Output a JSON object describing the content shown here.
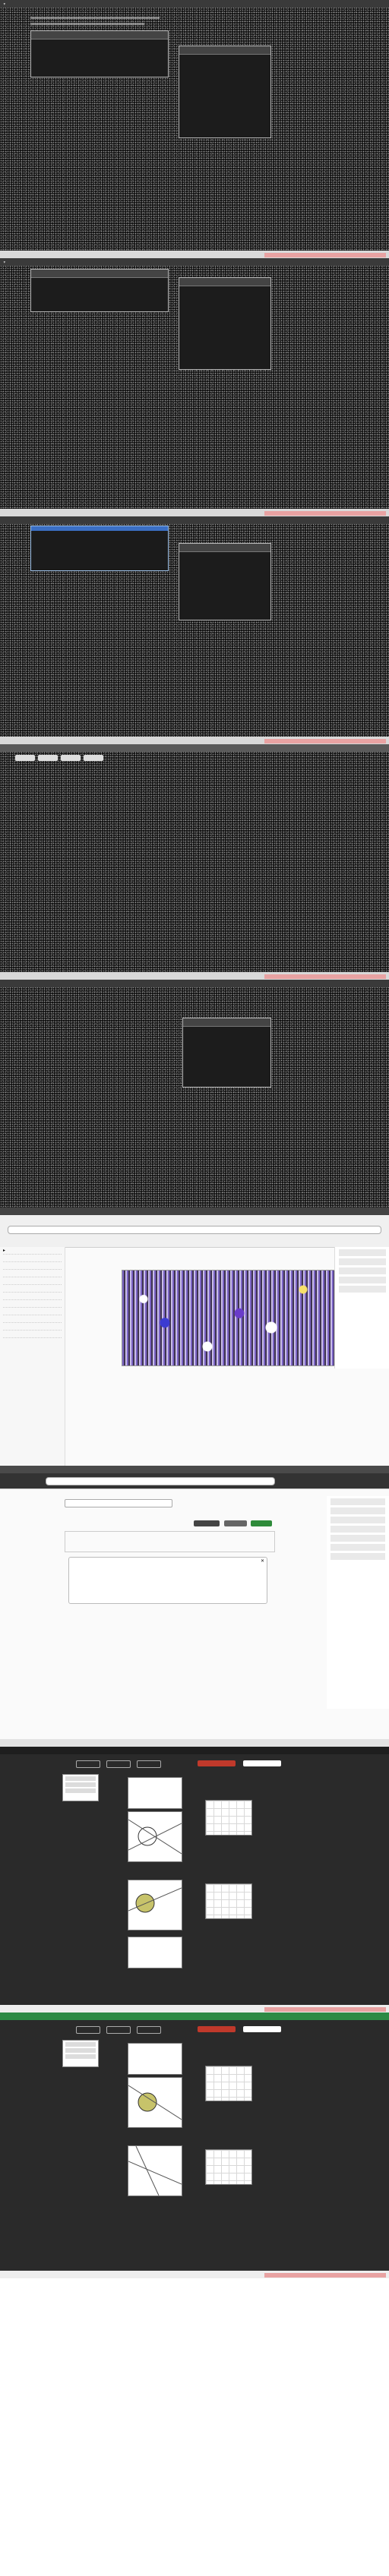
{
  "screens": [
    {
      "id": "screen-1",
      "kind": "dark-noisy-editor-with-dialog"
    },
    {
      "id": "screen-2",
      "kind": "dark-noisy-editor-with-dialog"
    },
    {
      "id": "screen-3",
      "kind": "dark-noisy-editor-with-dropdown-and-dialog"
    },
    {
      "id": "screen-4",
      "kind": "dark-noisy-editor-blank"
    },
    {
      "id": "screen-5",
      "kind": "dark-noisy-editor-with-dialog"
    },
    {
      "id": "screen-6",
      "kind": "file-browser-with-image-preview"
    },
    {
      "id": "screen-7",
      "kind": "web-form-with-sidebar"
    },
    {
      "id": "screen-8",
      "kind": "dark-app-with-sketches"
    },
    {
      "id": "screen-9",
      "kind": "dark-app-with-sketches"
    }
  ],
  "colors": {
    "noise_bg": "#141414",
    "panel_border": "#b8b8b8",
    "selection_blue": "#3b6fc4",
    "mosaic_purple": "#7a63c4",
    "mosaic_yellow": "#f7e06b",
    "url_red": "#e8a2a2",
    "dark_app_bg": "#2a2a2a",
    "accent_green": "#2e8b3a",
    "accent_red": "#c0392b"
  },
  "icons": [
    "close-icon",
    "chevron-down-icon",
    "folder-icon",
    "menu-icon",
    "search-icon"
  ]
}
